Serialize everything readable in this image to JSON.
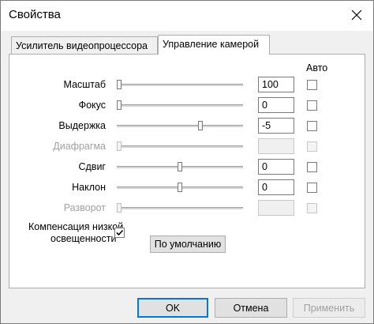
{
  "window": {
    "title": "Свойства"
  },
  "tabs": [
    {
      "label": "Усилитель видеопроцессора",
      "active": false
    },
    {
      "label": "Управление камерой",
      "active": true
    }
  ],
  "auto_header": "Авто",
  "controls": [
    {
      "label": "Масштаб",
      "value": "100",
      "enabled": true,
      "level": 0.0,
      "auto": false
    },
    {
      "label": "Фокус",
      "value": "0",
      "enabled": true,
      "level": 0.0,
      "auto": false
    },
    {
      "label": "Выдержка",
      "value": "-5",
      "enabled": true,
      "level": 0.67,
      "auto": false
    },
    {
      "label": "Диафрагма",
      "value": "",
      "enabled": false,
      "level": 0.0,
      "auto": false
    },
    {
      "label": "Сдвиг",
      "value": "0",
      "enabled": true,
      "level": 0.5,
      "auto": false
    },
    {
      "label": "Наклон",
      "value": "0",
      "enabled": true,
      "level": 0.5,
      "auto": false
    },
    {
      "label": "Разворот",
      "value": "",
      "enabled": false,
      "level": 0.0,
      "auto": false
    }
  ],
  "low_light": {
    "label_line1": "Компенсация низкой",
    "label_line2": "освещенности",
    "checked": true
  },
  "default_button": "По умолчанию",
  "footer": {
    "ok": "OK",
    "cancel": "Отмена",
    "apply": "Применить"
  }
}
